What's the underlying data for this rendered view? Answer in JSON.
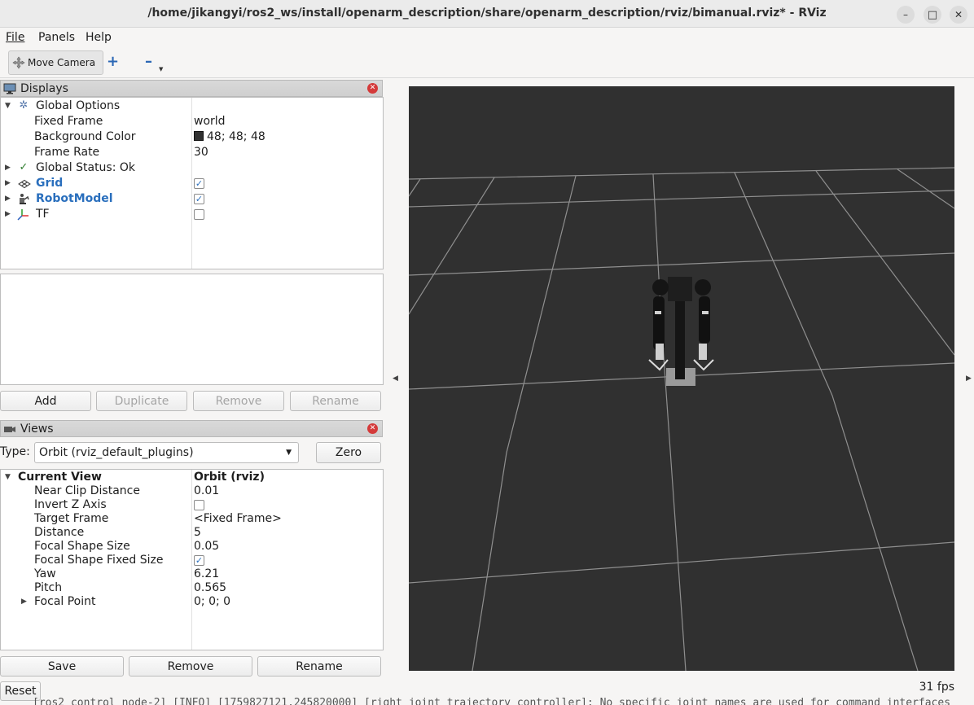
{
  "window": {
    "title": "/home/jikangyi/ros2_ws/install/openarm_description/share/openarm_description/rviz/bimanual.rviz* - RViz",
    "minimize": "–",
    "maximize": "□",
    "close": "✕"
  },
  "menu": {
    "file": "File",
    "panels": "Panels",
    "help": "Help"
  },
  "toolbar": {
    "move_camera": "Move Camera",
    "plus": "+",
    "minus": "–"
  },
  "displays": {
    "title": "Displays",
    "rows": [
      {
        "name": "Global Options",
        "value": ""
      },
      {
        "name": "Fixed Frame",
        "value": "world"
      },
      {
        "name": "Background Color",
        "value": "48; 48; 48"
      },
      {
        "name": "Frame Rate",
        "value": "30"
      },
      {
        "name": "Global Status: Ok",
        "value": ""
      },
      {
        "name": "Grid",
        "checked": true
      },
      {
        "name": "RobotModel",
        "checked": true
      },
      {
        "name": "TF",
        "checked": false
      }
    ],
    "buttons": {
      "add": "Add",
      "duplicate": "Duplicate",
      "remove": "Remove",
      "rename": "Rename"
    }
  },
  "views": {
    "title": "Views",
    "type_label": "Type:",
    "type_value": "Orbit (rviz_default_plugins)",
    "zero": "Zero",
    "rows": [
      {
        "name": "Current View",
        "value": "Orbit (rviz)"
      },
      {
        "name": "Near Clip Distance",
        "value": "0.01"
      },
      {
        "name": "Invert Z Axis",
        "checked": false
      },
      {
        "name": "Target Frame",
        "value": "<Fixed Frame>"
      },
      {
        "name": "Distance",
        "value": "5"
      },
      {
        "name": "Focal Shape Size",
        "value": "0.05"
      },
      {
        "name": "Focal Shape Fixed Size",
        "checked": true
      },
      {
        "name": "Yaw",
        "value": "6.21"
      },
      {
        "name": "Pitch",
        "value": "0.565"
      },
      {
        "name": "Focal Point",
        "value": "0; 0; 0"
      }
    ],
    "buttons": {
      "save": "Save",
      "remove": "Remove",
      "rename": "Rename"
    }
  },
  "viewport": {
    "background": "#303030"
  },
  "status": {
    "reset": "Reset",
    "fps": "31 fps",
    "log": "[ros2_control_node-2] [INFO] [1759827121.245820000] [right_joint_trajectory_controller]: No specific joint names are used for command interfaces"
  },
  "icons": {
    "displays": "monitor-icon",
    "views": "camera-icon",
    "global_options": "gear-icon",
    "global_status": "checkmark-icon",
    "grid": "grid-icon",
    "robot_model": "robot-icon",
    "tf": "axes-icon",
    "move_camera": "move-camera-icon"
  }
}
